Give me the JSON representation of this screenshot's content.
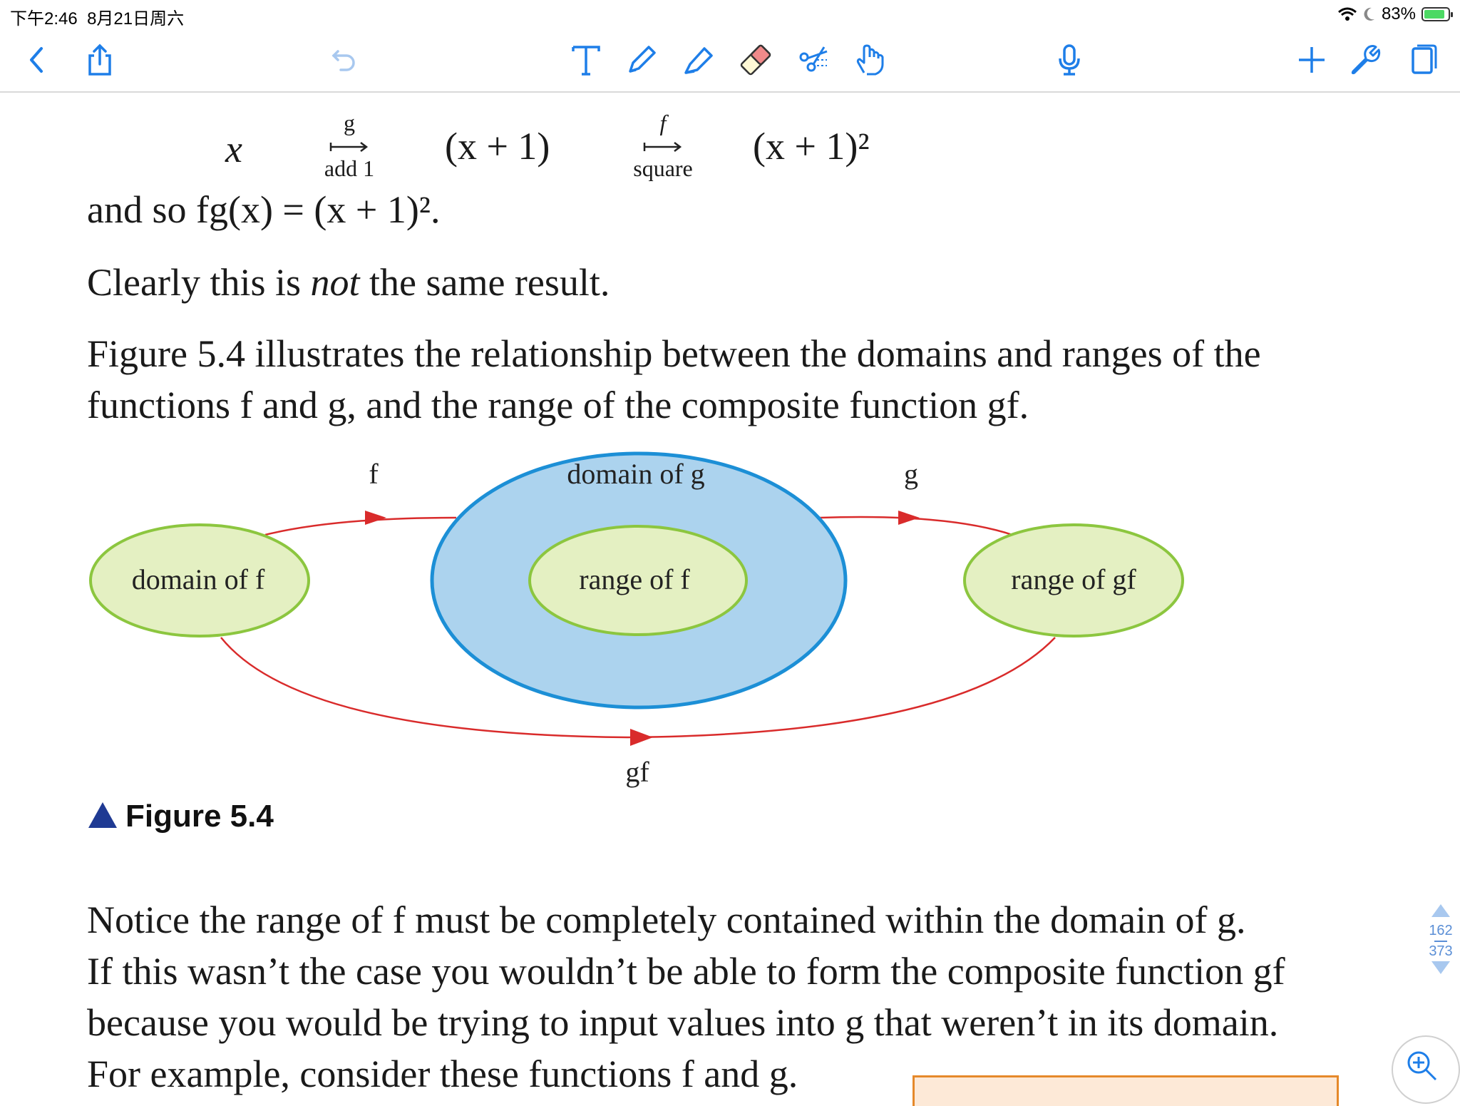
{
  "status_bar": {
    "time": "下午2:46",
    "date": "8月21日周六",
    "battery_pct": "83%"
  },
  "toolbar": {
    "icons": [
      "back-chevron-icon",
      "share-icon",
      "undo-icon",
      "text-tool-icon",
      "pen-icon",
      "highlighter-icon",
      "eraser-icon",
      "scissors-icon",
      "hand-icon",
      "microphone-icon",
      "add-icon",
      "wrench-icon",
      "page-icon"
    ]
  },
  "equation": {
    "x": "x",
    "g_label": "g",
    "g_sub": "add 1",
    "mid": "(x + 1)",
    "f_label": "f",
    "f_sub": "square",
    "end": "(x + 1)²"
  },
  "para1": "and so fg(x) = (x + 1)².",
  "para2_a": "Clearly this is ",
  "para2_em": "not",
  "para2_b": " the same result.",
  "para3_line1": "Figure 5.4 illustrates the relationship between the domains and ranges of the",
  "para3_line2": "functions f and g, and the range of the composite function gf.",
  "diagram": {
    "domain_f": "domain of f",
    "domain_g": "domain of g",
    "range_f": "range of f",
    "range_gf": "range of gf",
    "arrow_f": "f",
    "arrow_g": "g",
    "arrow_gf": "gf"
  },
  "caption": "Figure 5.4",
  "para4_lines": [
    "Notice the range of f must be completely contained within the domain of g.",
    "If this wasn’t the case you wouldn’t be able to form the composite function gf",
    "because you would be trying to input values into g that weren’t in its domain.",
    "For example, consider these functions f and g."
  ],
  "pager": {
    "current": "162",
    "total": "373"
  },
  "colors": {
    "accent": "#1e7ee8",
    "arrow_red": "#d92b2b",
    "ellipse_green_fill": "#e4f0c2",
    "ellipse_green_stroke": "#8cc63f",
    "ellipse_blue_fill": "#acd3ee",
    "ellipse_blue_stroke": "#1c8fd6"
  }
}
